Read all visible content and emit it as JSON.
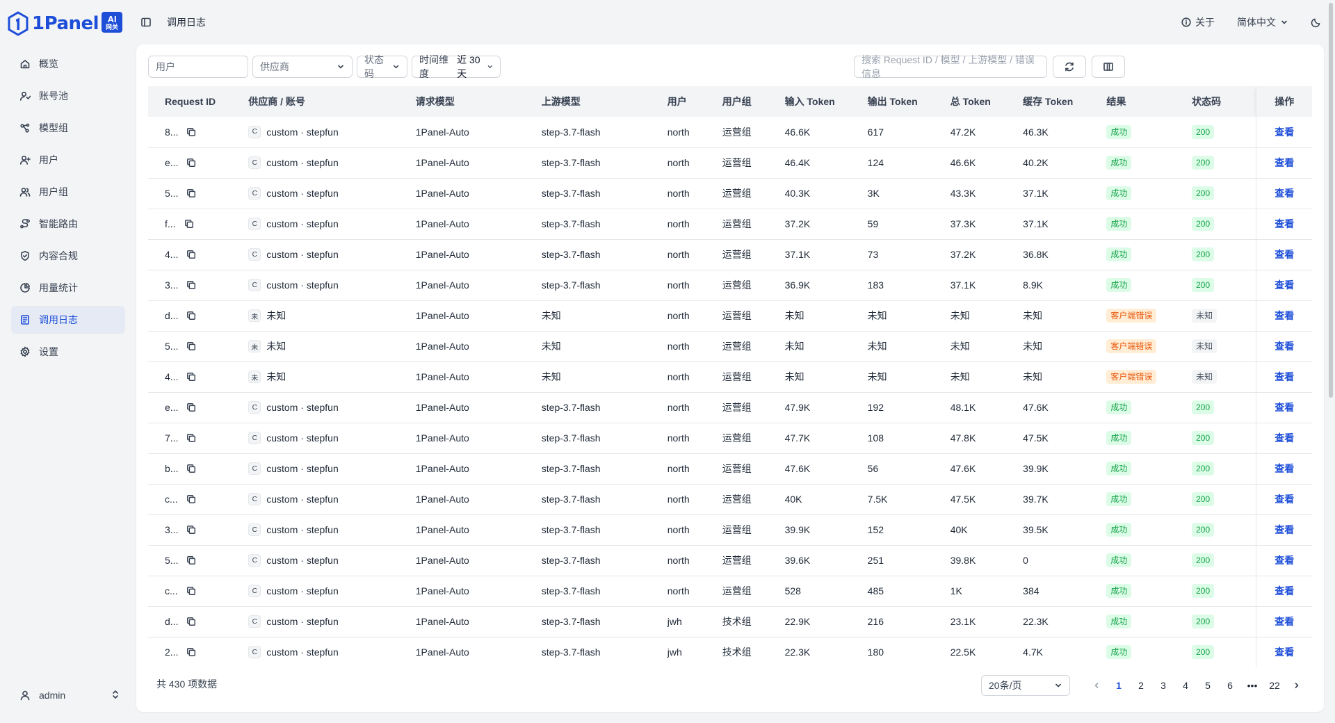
{
  "brand": {
    "name": "1Panel",
    "badge_top": "AI",
    "badge_bottom": "网关"
  },
  "sidebar": {
    "items": [
      {
        "label": "概览",
        "icon": "home-icon",
        "active": false
      },
      {
        "label": "账号池",
        "icon": "account-pool-icon",
        "active": false
      },
      {
        "label": "模型组",
        "icon": "model-group-icon",
        "active": false
      },
      {
        "label": "用户",
        "icon": "user-add-icon",
        "active": false
      },
      {
        "label": "用户组",
        "icon": "users-icon",
        "active": false
      },
      {
        "label": "智能路由",
        "icon": "route-icon",
        "active": false
      },
      {
        "label": "内容合规",
        "icon": "shield-check-icon",
        "active": false
      },
      {
        "label": "用量统计",
        "icon": "pie-chart-icon",
        "active": false
      },
      {
        "label": "调用日志",
        "icon": "log-icon",
        "active": true
      },
      {
        "label": "设置",
        "icon": "settings-icon",
        "active": false
      }
    ],
    "user": "admin"
  },
  "topbar": {
    "breadcrumb": "调用日志",
    "about": "关于",
    "language": "简体中文"
  },
  "filters": {
    "user_placeholder": "用户",
    "provider_placeholder": "供应商",
    "status_placeholder": "状态码",
    "time_label": "时间维度",
    "time_value": "近 30 天",
    "search_placeholder": "搜索 Request ID / 模型 / 上游模型 / 错误信息"
  },
  "table": {
    "columns": [
      "Request ID",
      "供应商 / 账号",
      "请求模型",
      "上游模型",
      "用户",
      "用户组",
      "输入 Token",
      "输出 Token",
      "总 Token",
      "缓存 Token",
      "结果",
      "状态码",
      "操作"
    ],
    "rows": [
      {
        "rid": "8...",
        "pb": "C",
        "provider": "custom · stepfun",
        "model": "1Panel-Auto",
        "upstream": "step-3.7-flash",
        "user": "north",
        "group": "运营组",
        "in": "46.6K",
        "out": "617",
        "total": "47.2K",
        "cache": "46.3K",
        "result": "成功",
        "result_type": "ok",
        "code": "200",
        "code_type": "ok",
        "action": "查看"
      },
      {
        "rid": "e...",
        "pb": "C",
        "provider": "custom · stepfun",
        "model": "1Panel-Auto",
        "upstream": "step-3.7-flash",
        "user": "north",
        "group": "运营组",
        "in": "46.4K",
        "out": "124",
        "total": "46.6K",
        "cache": "40.2K",
        "result": "成功",
        "result_type": "ok",
        "code": "200",
        "code_type": "ok",
        "action": "查看"
      },
      {
        "rid": "5...",
        "pb": "C",
        "provider": "custom · stepfun",
        "model": "1Panel-Auto",
        "upstream": "step-3.7-flash",
        "user": "north",
        "group": "运营组",
        "in": "40.3K",
        "out": "3K",
        "total": "43.3K",
        "cache": "37.1K",
        "result": "成功",
        "result_type": "ok",
        "code": "200",
        "code_type": "ok",
        "action": "查看"
      },
      {
        "rid": "f...",
        "pb": "C",
        "provider": "custom · stepfun",
        "model": "1Panel-Auto",
        "upstream": "step-3.7-flash",
        "user": "north",
        "group": "运营组",
        "in": "37.2K",
        "out": "59",
        "total": "37.3K",
        "cache": "37.1K",
        "result": "成功",
        "result_type": "ok",
        "code": "200",
        "code_type": "ok",
        "action": "查看"
      },
      {
        "rid": "4...",
        "pb": "C",
        "provider": "custom · stepfun",
        "model": "1Panel-Auto",
        "upstream": "step-3.7-flash",
        "user": "north",
        "group": "运营组",
        "in": "37.1K",
        "out": "73",
        "total": "37.2K",
        "cache": "36.8K",
        "result": "成功",
        "result_type": "ok",
        "code": "200",
        "code_type": "ok",
        "action": "查看"
      },
      {
        "rid": "3...",
        "pb": "C",
        "provider": "custom · stepfun",
        "model": "1Panel-Auto",
        "upstream": "step-3.7-flash",
        "user": "north",
        "group": "运营组",
        "in": "36.9K",
        "out": "183",
        "total": "37.1K",
        "cache": "8.9K",
        "result": "成功",
        "result_type": "ok",
        "code": "200",
        "code_type": "ok",
        "action": "查看"
      },
      {
        "rid": "d...",
        "pb": "未",
        "provider": "未知",
        "model": "1Panel-Auto",
        "upstream": "未知",
        "user": "north",
        "group": "运营组",
        "in": "未知",
        "out": "未知",
        "total": "未知",
        "cache": "未知",
        "result": "客户端错误",
        "result_type": "err",
        "code": "未知",
        "code_type": "unk",
        "action": "查看"
      },
      {
        "rid": "5...",
        "pb": "未",
        "provider": "未知",
        "model": "1Panel-Auto",
        "upstream": "未知",
        "user": "north",
        "group": "运营组",
        "in": "未知",
        "out": "未知",
        "total": "未知",
        "cache": "未知",
        "result": "客户端错误",
        "result_type": "err",
        "code": "未知",
        "code_type": "unk",
        "action": "查看"
      },
      {
        "rid": "4...",
        "pb": "未",
        "provider": "未知",
        "model": "1Panel-Auto",
        "upstream": "未知",
        "user": "north",
        "group": "运营组",
        "in": "未知",
        "out": "未知",
        "total": "未知",
        "cache": "未知",
        "result": "客户端错误",
        "result_type": "err",
        "code": "未知",
        "code_type": "unk",
        "action": "查看"
      },
      {
        "rid": "e...",
        "pb": "C",
        "provider": "custom · stepfun",
        "model": "1Panel-Auto",
        "upstream": "step-3.7-flash",
        "user": "north",
        "group": "运营组",
        "in": "47.9K",
        "out": "192",
        "total": "48.1K",
        "cache": "47.6K",
        "result": "成功",
        "result_type": "ok",
        "code": "200",
        "code_type": "ok",
        "action": "查看"
      },
      {
        "rid": "7...",
        "pb": "C",
        "provider": "custom · stepfun",
        "model": "1Panel-Auto",
        "upstream": "step-3.7-flash",
        "user": "north",
        "group": "运营组",
        "in": "47.7K",
        "out": "108",
        "total": "47.8K",
        "cache": "47.5K",
        "result": "成功",
        "result_type": "ok",
        "code": "200",
        "code_type": "ok",
        "action": "查看"
      },
      {
        "rid": "b...",
        "pb": "C",
        "provider": "custom · stepfun",
        "model": "1Panel-Auto",
        "upstream": "step-3.7-flash",
        "user": "north",
        "group": "运营组",
        "in": "47.6K",
        "out": "56",
        "total": "47.6K",
        "cache": "39.9K",
        "result": "成功",
        "result_type": "ok",
        "code": "200",
        "code_type": "ok",
        "action": "查看"
      },
      {
        "rid": "c...",
        "pb": "C",
        "provider": "custom · stepfun",
        "model": "1Panel-Auto",
        "upstream": "step-3.7-flash",
        "user": "north",
        "group": "运营组",
        "in": "40K",
        "out": "7.5K",
        "total": "47.5K",
        "cache": "39.7K",
        "result": "成功",
        "result_type": "ok",
        "code": "200",
        "code_type": "ok",
        "action": "查看"
      },
      {
        "rid": "3...",
        "pb": "C",
        "provider": "custom · stepfun",
        "model": "1Panel-Auto",
        "upstream": "step-3.7-flash",
        "user": "north",
        "group": "运营组",
        "in": "39.9K",
        "out": "152",
        "total": "40K",
        "cache": "39.5K",
        "result": "成功",
        "result_type": "ok",
        "code": "200",
        "code_type": "ok",
        "action": "查看"
      },
      {
        "rid": "5...",
        "pb": "C",
        "provider": "custom · stepfun",
        "model": "1Panel-Auto",
        "upstream": "step-3.7-flash",
        "user": "north",
        "group": "运营组",
        "in": "39.6K",
        "out": "251",
        "total": "39.8K",
        "cache": "0",
        "result": "成功",
        "result_type": "ok",
        "code": "200",
        "code_type": "ok",
        "action": "查看"
      },
      {
        "rid": "c...",
        "pb": "C",
        "provider": "custom · stepfun",
        "model": "1Panel-Auto",
        "upstream": "step-3.7-flash",
        "user": "north",
        "group": "运营组",
        "in": "528",
        "out": "485",
        "total": "1K",
        "cache": "384",
        "result": "成功",
        "result_type": "ok",
        "code": "200",
        "code_type": "ok",
        "action": "查看"
      },
      {
        "rid": "d...",
        "pb": "C",
        "provider": "custom · stepfun",
        "model": "1Panel-Auto",
        "upstream": "step-3.7-flash",
        "user": "jwh",
        "group": "技术组",
        "in": "22.9K",
        "out": "216",
        "total": "23.1K",
        "cache": "22.3K",
        "result": "成功",
        "result_type": "ok",
        "code": "200",
        "code_type": "ok",
        "action": "查看"
      },
      {
        "rid": "2...",
        "pb": "C",
        "provider": "custom · stepfun",
        "model": "1Panel-Auto",
        "upstream": "step-3.7-flash",
        "user": "jwh",
        "group": "技术组",
        "in": "22.3K",
        "out": "180",
        "total": "22.5K",
        "cache": "4.7K",
        "result": "成功",
        "result_type": "ok",
        "code": "200",
        "code_type": "ok",
        "action": "查看"
      }
    ]
  },
  "pagination": {
    "total_text": "共 430 项数据",
    "page_size": "20条/页",
    "pages": [
      "1",
      "2",
      "3",
      "4",
      "5",
      "6",
      "•••",
      "22"
    ],
    "current": "1"
  },
  "colors": {
    "accent": "#1d4ed8",
    "success_bg": "#dcfce7",
    "success_fg": "#16a34a",
    "error_bg": "#ffedd5",
    "error_fg": "#ea580c"
  }
}
